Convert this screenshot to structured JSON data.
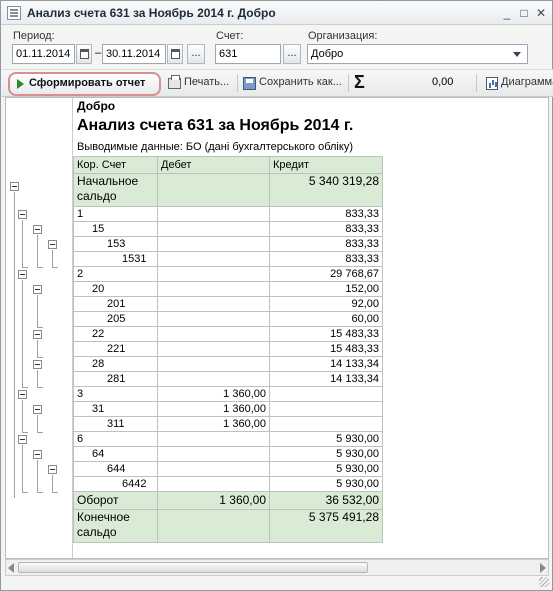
{
  "window": {
    "title": "Анализ счета 631 за Ноябрь 2014 г. Добро",
    "buttons": {
      "minimize": "_",
      "maximize": "□",
      "close": "✕"
    }
  },
  "filters": {
    "period_label": "Период:",
    "date_from": "01.11.2014",
    "date_separator": "–",
    "date_to": "30.11.2014",
    "ellipsis": "...",
    "account_label": "Счет:",
    "account_value": "631",
    "org_label": "Организация:",
    "org_value": "Добро"
  },
  "toolbar": {
    "generate": "Сформировать отчет",
    "print": "Печать...",
    "save": "Сохранить как...",
    "sigma": "Σ",
    "sum_value": "0,00",
    "diagram": "Диаграмма"
  },
  "report": {
    "org": "Добро",
    "title": "Анализ счета 631 за Ноябрь 2014 г.",
    "subtitle": "Выводимые данные:  БО (дані бухгалтерського обліку)",
    "headers": [
      "Кор. Счет",
      "Дебет",
      "Кредит"
    ],
    "opening": {
      "label": "Начальное сальдо",
      "debit": "",
      "credit": "5 340 319,28"
    },
    "rows": [
      {
        "account": "1",
        "debit": "",
        "credit": "833,33"
      },
      {
        "account": "15",
        "debit": "",
        "credit": "833,33"
      },
      {
        "account": "153",
        "debit": "",
        "credit": "833,33"
      },
      {
        "account": "1531",
        "debit": "",
        "credit": "833,33"
      },
      {
        "account": "2",
        "debit": "",
        "credit": "29 768,67"
      },
      {
        "account": "20",
        "debit": "",
        "credit": "152,00"
      },
      {
        "account": "201",
        "debit": "",
        "credit": "92,00"
      },
      {
        "account": "205",
        "debit": "",
        "credit": "60,00"
      },
      {
        "account": "22",
        "debit": "",
        "credit": "15 483,33"
      },
      {
        "account": "221",
        "debit": "",
        "credit": "15 483,33"
      },
      {
        "account": "28",
        "debit": "",
        "credit": "14 133,34"
      },
      {
        "account": "281",
        "debit": "",
        "credit": "14 133,34"
      },
      {
        "account": "3",
        "debit": "1 360,00",
        "credit": ""
      },
      {
        "account": "31",
        "debit": "1 360,00",
        "credit": ""
      },
      {
        "account": "311",
        "debit": "1 360,00",
        "credit": ""
      },
      {
        "account": "6",
        "debit": "",
        "credit": "5 930,00"
      },
      {
        "account": "64",
        "debit": "",
        "credit": "5 930,00"
      },
      {
        "account": "644",
        "debit": "",
        "credit": "5 930,00"
      },
      {
        "account": "6442",
        "debit": "",
        "credit": "5 930,00"
      }
    ],
    "turnover": {
      "label": "Оборот",
      "debit": "1 360,00",
      "credit": "36 532,00"
    },
    "closing": {
      "label": "Конечное сальдо",
      "debit": "",
      "credit": "5 375 491,28"
    }
  },
  "colors": {
    "header_green": "#d9ead5",
    "highlight_border": "#d78f93",
    "play_green": "#2e8a2a"
  }
}
